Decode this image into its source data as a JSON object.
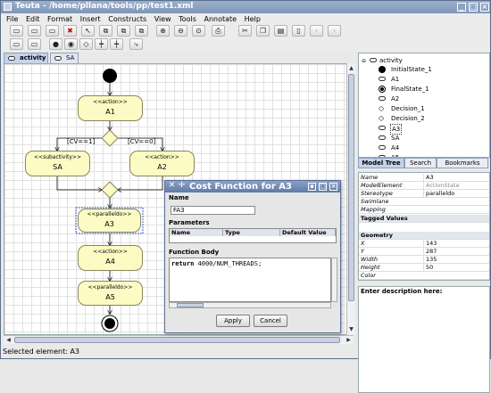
{
  "window": {
    "title": "Teuta - /home/pllana/tools/pp/test1.xml"
  },
  "menu": [
    "File",
    "Edit",
    "Format",
    "Insert",
    "Constructs",
    "View",
    "Tools",
    "Annotate",
    "Help"
  ],
  "editor_tabs": [
    {
      "label": "activity",
      "active": true
    },
    {
      "label": "SA",
      "active": false
    }
  ],
  "diagram": {
    "action_stereotype": "<<action>>",
    "subactivity_stereotype": "<<subactivity>>",
    "parallel_stereotype": "<<paralleldo>>",
    "a1": "A1",
    "sa": "SA",
    "a2": "A2",
    "a3": "A3",
    "a4": "A4",
    "a5": "A5",
    "guard_left": "[CV==1]",
    "guard_right": "[CV==0]"
  },
  "tree": {
    "root": "activity",
    "items": [
      "InitialState_1",
      "A1",
      "FinalState_1",
      "A2",
      "Decision_1",
      "Decision_2",
      "A3",
      "SA",
      "A4",
      "A5"
    ]
  },
  "right_tabs": [
    "Model Tree",
    "Search",
    "Bookmarks"
  ],
  "properties": [
    {
      "key": "Name",
      "value": "A3"
    },
    {
      "key": "ModelElement",
      "value": "ActionState"
    },
    {
      "key": "Stereotype",
      "value": "paralleldo"
    },
    {
      "key": "Swimlane",
      "value": ""
    },
    {
      "key": "Mapping",
      "value": ""
    }
  ],
  "sections": {
    "tagged": "Tagged Values",
    "geometry": "Geometry"
  },
  "geometry": [
    {
      "key": "X",
      "value": "143"
    },
    {
      "key": "Y",
      "value": "287"
    },
    {
      "key": "Width",
      "value": "135"
    },
    {
      "key": "Height",
      "value": "50"
    },
    {
      "key": "Color",
      "value": ""
    }
  ],
  "description_label": "Enter description here:",
  "status": "Selected element:  A3",
  "dialog": {
    "title": "Cost Function for A3",
    "name_label": "Name",
    "name_value": "FA3",
    "params_label": "Parameters",
    "params_cols": [
      "Name",
      "Type",
      "Default Value"
    ],
    "body_label": "Function Body",
    "code_keyword": "return",
    "code_rest": " 4000/NUM_THREADS;",
    "apply": "Apply",
    "cancel": "Cancel"
  },
  "colors": {
    "node_fill": "#fdfbc4",
    "node_border": "#8b8360",
    "selection": "#3b5fd0"
  }
}
